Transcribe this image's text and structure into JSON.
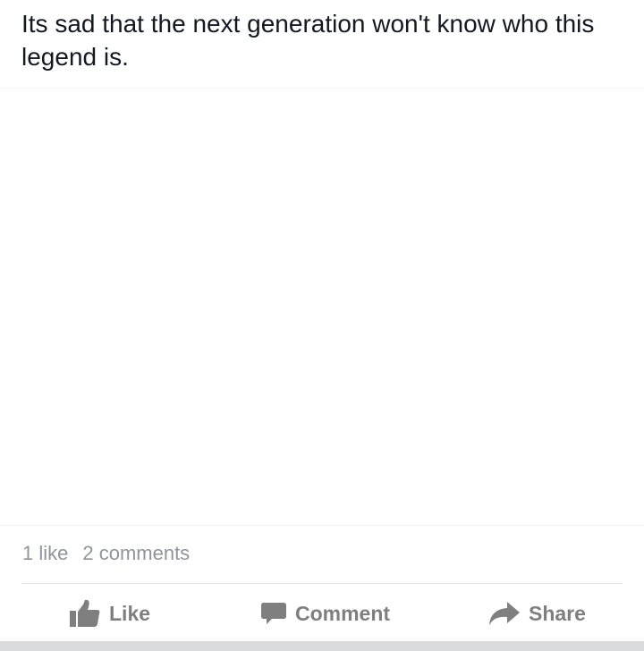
{
  "post": {
    "text": "Its sad that the next generation won't know who this legend is."
  },
  "stats": {
    "likes": "1 like",
    "comments": "2 comments"
  },
  "actions": {
    "like_label": "Like",
    "comment_label": "Comment",
    "share_label": "Share",
    "like_icon": "thumbs-up-icon",
    "comment_icon": "speech-bubble-icon",
    "share_icon": "share-arrow-icon"
  },
  "colors": {
    "text_primary": "#141823",
    "text_secondary": "#90949c",
    "action_gray": "#7f7f7f",
    "divider": "#e5e6e9",
    "bottom_bar": "#dadbdf"
  }
}
